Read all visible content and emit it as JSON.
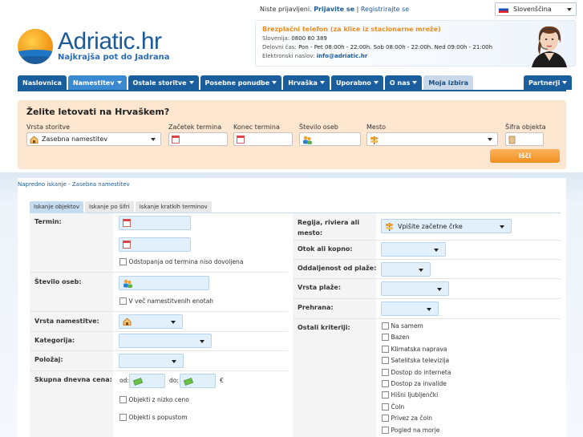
{
  "header": {
    "login_text": "Niste prijavljeni.",
    "login_link": "Prijavite se",
    "separator": "|",
    "register_link": "Registrirajte se",
    "language": "Slovenščina",
    "logo_title": "Adriatic.hr",
    "logo_subtitle": "Najkrajša pot do Jadrana"
  },
  "contact": {
    "headline": "Brezplačni telefon (za klice iz stacionarne mreže)",
    "phone_label": "Slovenija:",
    "phone": "0800 80 389",
    "hours_label": "Delovni čas:",
    "hours": "Pon - Pet 08:00h - 22:00h. Sob 08:00h - 22:00h. Ned 09:00h - 21:00h",
    "email_label": "Elektronski naslov:",
    "email": "info@adriatic.hr"
  },
  "nav": {
    "items": [
      {
        "label": "Naslovnica",
        "dropdown": false
      },
      {
        "label": "Namestitev",
        "dropdown": true
      },
      {
        "label": "Ostale storitve",
        "dropdown": true
      },
      {
        "label": "Posebne ponudbe",
        "dropdown": true
      },
      {
        "label": "Hrvaška",
        "dropdown": true
      },
      {
        "label": "Uporabno",
        "dropdown": true
      },
      {
        "label": "O nas",
        "dropdown": true
      },
      {
        "label": "Moja izbira",
        "dropdown": false
      }
    ],
    "partners": "Partnerji"
  },
  "quick_search": {
    "title": "Želite letovati na Hrvaškem?",
    "service_label": "Vrsta storitve",
    "service_value": "Zasebna namestitev",
    "start_label": "Začetek termina",
    "end_label": "Konec termina",
    "persons_label": "Število oseb",
    "place_label": "Mesto",
    "code_label": "Šifra objekta",
    "search_button": "Išči"
  },
  "breadcrumb": "Napredno iskanje - Zasebna namestitev",
  "tabs": [
    "Iskanje objektov",
    "Iskanje po šifri",
    "Iskanje kratkih terminov"
  ],
  "left_form": {
    "term_label": "Termin:",
    "term_deviation": "Odstopanja od termina niso dovoljena",
    "persons_label": "Število oseb:",
    "multiple_units": "V več namestitvenih enotah",
    "accommodation_type_label": "Vrsta namestitve:",
    "category_label": "Kategorija:",
    "position_label": "Položaj:",
    "daily_price_label": "Skupna dnevna cena:",
    "price_from": "od:",
    "price_to": "do:",
    "currency": "€",
    "low_price": "Objekti z nizko ceno",
    "discount": "Objekti s popustom"
  },
  "right_form": {
    "region_label": "Regija, riviera ali mesto:",
    "region_placeholder": "Vpišite začetne črke",
    "island_label": "Otok ali kopno:",
    "beach_distance_label": "Oddaljenost od plaže:",
    "beach_type_label": "Vrsta plaže:",
    "meals_label": "Prehrana:",
    "other_criteria_label": "Ostali kriteriji:",
    "criteria": [
      "Na samem",
      "Bazen",
      "Klimatska naprava",
      "Satelitska televizija",
      "Dostop do interneta",
      "Dostop za invalide",
      "Hišni ljubljenčki",
      "Čoln",
      "Privez za čoln",
      "Pogled na morje"
    ]
  },
  "colors": {
    "nav_blue": "#1a5e9e",
    "search_bg": "#fce6cf",
    "accent_orange": "#f0901e",
    "field_blue": "#e2f0fc"
  }
}
